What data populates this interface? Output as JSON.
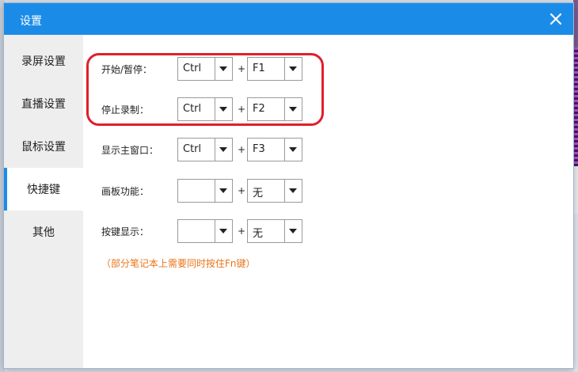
{
  "dialog": {
    "title": "设置"
  },
  "sidebar": {
    "items": [
      {
        "label": "录屏设置",
        "active": false
      },
      {
        "label": "直播设置",
        "active": false
      },
      {
        "label": "鼠标设置",
        "active": false
      },
      {
        "label": "快捷键",
        "active": true
      },
      {
        "label": "其他",
        "active": false
      }
    ]
  },
  "shortcuts": {
    "plus": "+",
    "rows": [
      {
        "label": "开始/暂停：",
        "modifier": "Ctrl",
        "key": "F1"
      },
      {
        "label": "停止录制：",
        "modifier": "Ctrl",
        "key": "F2"
      },
      {
        "label": "显示主窗口：",
        "modifier": "Ctrl",
        "key": "F3"
      },
      {
        "label": "画板功能：",
        "modifier": "",
        "key": "无"
      },
      {
        "label": "按键显示：",
        "modifier": "",
        "key": "无"
      }
    ],
    "note": "（部分笔记本上需要同时按住Fn键）"
  },
  "colors": {
    "accent": "#1a8ce8",
    "note": "#e8741a",
    "highlight": "#e01f2b"
  },
  "icons": {
    "close": "close-icon",
    "dropdown": "chevron-down-icon"
  }
}
